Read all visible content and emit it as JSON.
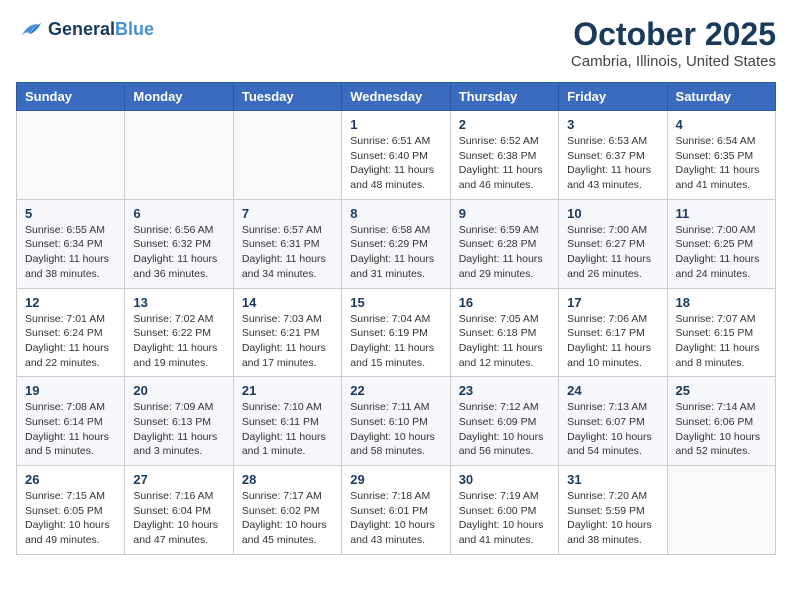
{
  "header": {
    "logo_line1": "General",
    "logo_line2": "Blue",
    "month": "October 2025",
    "location": "Cambria, Illinois, United States"
  },
  "weekdays": [
    "Sunday",
    "Monday",
    "Tuesday",
    "Wednesday",
    "Thursday",
    "Friday",
    "Saturday"
  ],
  "weeks": [
    [
      {
        "day": "",
        "info": ""
      },
      {
        "day": "",
        "info": ""
      },
      {
        "day": "",
        "info": ""
      },
      {
        "day": "1",
        "info": "Sunrise: 6:51 AM\nSunset: 6:40 PM\nDaylight: 11 hours\nand 48 minutes."
      },
      {
        "day": "2",
        "info": "Sunrise: 6:52 AM\nSunset: 6:38 PM\nDaylight: 11 hours\nand 46 minutes."
      },
      {
        "day": "3",
        "info": "Sunrise: 6:53 AM\nSunset: 6:37 PM\nDaylight: 11 hours\nand 43 minutes."
      },
      {
        "day": "4",
        "info": "Sunrise: 6:54 AM\nSunset: 6:35 PM\nDaylight: 11 hours\nand 41 minutes."
      }
    ],
    [
      {
        "day": "5",
        "info": "Sunrise: 6:55 AM\nSunset: 6:34 PM\nDaylight: 11 hours\nand 38 minutes."
      },
      {
        "day": "6",
        "info": "Sunrise: 6:56 AM\nSunset: 6:32 PM\nDaylight: 11 hours\nand 36 minutes."
      },
      {
        "day": "7",
        "info": "Sunrise: 6:57 AM\nSunset: 6:31 PM\nDaylight: 11 hours\nand 34 minutes."
      },
      {
        "day": "8",
        "info": "Sunrise: 6:58 AM\nSunset: 6:29 PM\nDaylight: 11 hours\nand 31 minutes."
      },
      {
        "day": "9",
        "info": "Sunrise: 6:59 AM\nSunset: 6:28 PM\nDaylight: 11 hours\nand 29 minutes."
      },
      {
        "day": "10",
        "info": "Sunrise: 7:00 AM\nSunset: 6:27 PM\nDaylight: 11 hours\nand 26 minutes."
      },
      {
        "day": "11",
        "info": "Sunrise: 7:00 AM\nSunset: 6:25 PM\nDaylight: 11 hours\nand 24 minutes."
      }
    ],
    [
      {
        "day": "12",
        "info": "Sunrise: 7:01 AM\nSunset: 6:24 PM\nDaylight: 11 hours\nand 22 minutes."
      },
      {
        "day": "13",
        "info": "Sunrise: 7:02 AM\nSunset: 6:22 PM\nDaylight: 11 hours\nand 19 minutes."
      },
      {
        "day": "14",
        "info": "Sunrise: 7:03 AM\nSunset: 6:21 PM\nDaylight: 11 hours\nand 17 minutes."
      },
      {
        "day": "15",
        "info": "Sunrise: 7:04 AM\nSunset: 6:19 PM\nDaylight: 11 hours\nand 15 minutes."
      },
      {
        "day": "16",
        "info": "Sunrise: 7:05 AM\nSunset: 6:18 PM\nDaylight: 11 hours\nand 12 minutes."
      },
      {
        "day": "17",
        "info": "Sunrise: 7:06 AM\nSunset: 6:17 PM\nDaylight: 11 hours\nand 10 minutes."
      },
      {
        "day": "18",
        "info": "Sunrise: 7:07 AM\nSunset: 6:15 PM\nDaylight: 11 hours\nand 8 minutes."
      }
    ],
    [
      {
        "day": "19",
        "info": "Sunrise: 7:08 AM\nSunset: 6:14 PM\nDaylight: 11 hours\nand 5 minutes."
      },
      {
        "day": "20",
        "info": "Sunrise: 7:09 AM\nSunset: 6:13 PM\nDaylight: 11 hours\nand 3 minutes."
      },
      {
        "day": "21",
        "info": "Sunrise: 7:10 AM\nSunset: 6:11 PM\nDaylight: 11 hours\nand 1 minute."
      },
      {
        "day": "22",
        "info": "Sunrise: 7:11 AM\nSunset: 6:10 PM\nDaylight: 10 hours\nand 58 minutes."
      },
      {
        "day": "23",
        "info": "Sunrise: 7:12 AM\nSunset: 6:09 PM\nDaylight: 10 hours\nand 56 minutes."
      },
      {
        "day": "24",
        "info": "Sunrise: 7:13 AM\nSunset: 6:07 PM\nDaylight: 10 hours\nand 54 minutes."
      },
      {
        "day": "25",
        "info": "Sunrise: 7:14 AM\nSunset: 6:06 PM\nDaylight: 10 hours\nand 52 minutes."
      }
    ],
    [
      {
        "day": "26",
        "info": "Sunrise: 7:15 AM\nSunset: 6:05 PM\nDaylight: 10 hours\nand 49 minutes."
      },
      {
        "day": "27",
        "info": "Sunrise: 7:16 AM\nSunset: 6:04 PM\nDaylight: 10 hours\nand 47 minutes."
      },
      {
        "day": "28",
        "info": "Sunrise: 7:17 AM\nSunset: 6:02 PM\nDaylight: 10 hours\nand 45 minutes."
      },
      {
        "day": "29",
        "info": "Sunrise: 7:18 AM\nSunset: 6:01 PM\nDaylight: 10 hours\nand 43 minutes."
      },
      {
        "day": "30",
        "info": "Sunrise: 7:19 AM\nSunset: 6:00 PM\nDaylight: 10 hours\nand 41 minutes."
      },
      {
        "day": "31",
        "info": "Sunrise: 7:20 AM\nSunset: 5:59 PM\nDaylight: 10 hours\nand 38 minutes."
      },
      {
        "day": "",
        "info": ""
      }
    ]
  ]
}
